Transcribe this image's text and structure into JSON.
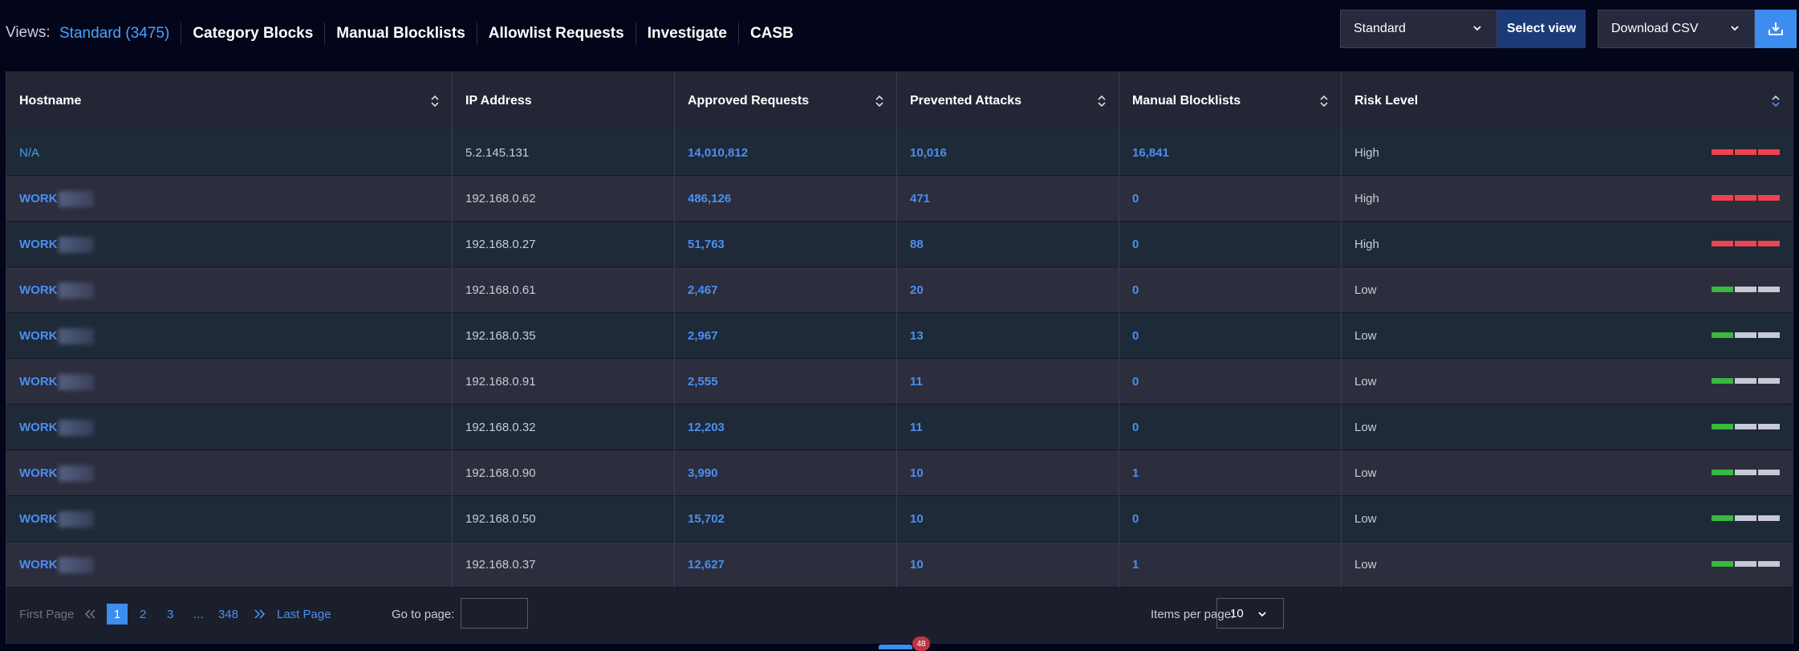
{
  "views": {
    "label": "Views:",
    "tabs": [
      {
        "label": "Standard (3475)",
        "active": true
      },
      {
        "label": "Category Blocks"
      },
      {
        "label": "Manual Blocklists"
      },
      {
        "label": "Allowlist Requests"
      },
      {
        "label": "Investigate"
      },
      {
        "label": "CASB"
      }
    ]
  },
  "toolbar": {
    "view_select_value": "Standard",
    "select_view_label": "Select view",
    "download_select_value": "Download CSV"
  },
  "table": {
    "columns": [
      "Hostname",
      "IP Address",
      "Approved Requests",
      "Prevented Attacks",
      "Manual Blocklists",
      "Risk Level"
    ],
    "rows": [
      {
        "hostname": "N/A",
        "ip": "5.2.145.131",
        "approved": "14,010,812",
        "prevented": "10,016",
        "blocklists": "16,841",
        "risk": "High"
      },
      {
        "hostname": "WORK",
        "ip": "192.168.0.62",
        "approved": "486,126",
        "prevented": "471",
        "blocklists": "0",
        "risk": "High"
      },
      {
        "hostname": "WORK",
        "ip": "192.168.0.27",
        "approved": "51,763",
        "prevented": "88",
        "blocklists": "0",
        "risk": "High"
      },
      {
        "hostname": "WORK",
        "ip": "192.168.0.61",
        "approved": "2,467",
        "prevented": "20",
        "blocklists": "0",
        "risk": "Low"
      },
      {
        "hostname": "WORK",
        "ip": "192.168.0.35",
        "approved": "2,967",
        "prevented": "13",
        "blocklists": "0",
        "risk": "Low"
      },
      {
        "hostname": "WORK",
        "ip": "192.168.0.91",
        "approved": "2,555",
        "prevented": "11",
        "blocklists": "0",
        "risk": "Low"
      },
      {
        "hostname": "WORK",
        "ip": "192.168.0.32",
        "approved": "12,203",
        "prevented": "11",
        "blocklists": "0",
        "risk": "Low"
      },
      {
        "hostname": "WORK",
        "ip": "192.168.0.90",
        "approved": "3,990",
        "prevented": "10",
        "blocklists": "1",
        "risk": "Low"
      },
      {
        "hostname": "WORK",
        "ip": "192.168.0.50",
        "approved": "15,702",
        "prevented": "10",
        "blocklists": "0",
        "risk": "Low"
      },
      {
        "hostname": "WORK",
        "ip": "192.168.0.37",
        "approved": "12,627",
        "prevented": "10",
        "blocklists": "1",
        "risk": "Low"
      }
    ]
  },
  "risk_colors": {
    "high": "#f0414f",
    "low": "#39b93f",
    "empty": "#c7c9d6"
  },
  "pagination": {
    "first_page": "First Page",
    "current": "1",
    "pages": [
      "2",
      "3"
    ],
    "ellipsis": "...",
    "last_number": "348",
    "last_page": "Last Page",
    "goto_label": "Go to page:",
    "goto_value": "",
    "items_per_page_label": "Items per page:",
    "items_per_page_value": "10"
  },
  "notification_count": "48",
  "colors": {
    "accent": "#3d8cf0",
    "background": "#03061a",
    "header": "#232634"
  }
}
